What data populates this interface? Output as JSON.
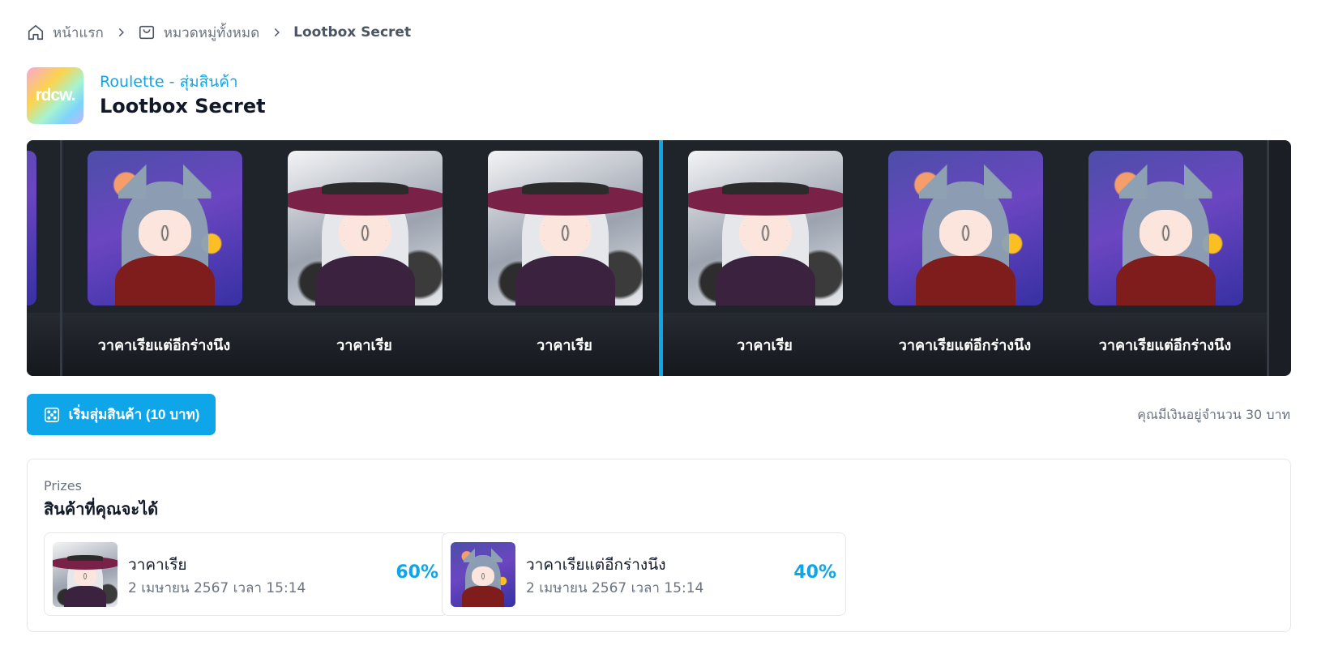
{
  "breadcrumb": {
    "home": "หน้าแรก",
    "categories": "หมวดหมู่ทั้งหมด",
    "current": "Lootbox Secret"
  },
  "header": {
    "logo_text": "rdcw.",
    "subtitle": "Roulette - สุ่มสินค้า",
    "title": "Lootbox Secret"
  },
  "roulette": {
    "items": [
      {
        "label": "",
        "art": "purple"
      },
      {
        "label": "วาคาเรียแต่อีกร่างนึง",
        "art": "purple"
      },
      {
        "label": "วาคาเรีย",
        "art": "grey"
      },
      {
        "label": "วาคาเรีย",
        "art": "grey"
      },
      {
        "label": "วาคาเรีย",
        "art": "grey"
      },
      {
        "label": "วาคาเรียแต่อีกร่างนึง",
        "art": "purple"
      },
      {
        "label": "วาคาเรียแต่อีกร่างนึง",
        "art": "purple"
      }
    ],
    "pointer_color": "#0ea5e9"
  },
  "actions": {
    "spin_label": "เริ่มสุ่มสินค้า (10 บาท)",
    "spin_icon": "dice-icon",
    "balance_text": "คุณมีเงินอยู่จำนวน 30 บาท"
  },
  "prizes": {
    "eyebrow": "Prizes",
    "title": "สินค้าที่คุณจะได้",
    "items": [
      {
        "name": "วาคาเรีย",
        "date": "2 เมษายน 2567 เวลา 15:14",
        "chance": "60%",
        "art": "grey"
      },
      {
        "name": "วาคาเรียแต่อีกร่างนึง",
        "date": "2 เมษายน 2567 เวลา 15:14",
        "chance": "40%",
        "art": "purple"
      }
    ]
  },
  "colors": {
    "accent": "#0ea5e9",
    "strip_bg": "#1b1e24"
  }
}
